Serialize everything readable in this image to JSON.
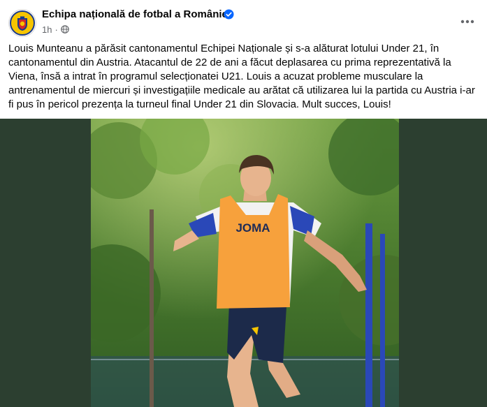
{
  "post": {
    "page_name": "Echipa națională de fotbal a României",
    "timestamp": "1h",
    "separator": "·",
    "privacy_icon": "globe-icon",
    "verified_icon": "verified-badge-icon",
    "more_icon": "more-options-icon",
    "text": "Louis Munteanu a părăsit cantonamentul Echipei Naționale și s-a alăturat lotului Under 21, în cantonamentul din Austria. Atacantul de 22 de ani a făcut deplasarea cu prima reprezentativă la Viena, însă a intrat în programul selecționatei U21. Louis a acuzat probleme musculare la antrenamentul de miercuri și investigațiile medicale au arătat că utilizarea lui la partida cu Austria i-ar fi pus în pericol prezența la turneul final Under 21 din Slovacia. Mult succes, Louis!"
  },
  "photo": {
    "bib_text": "JOMA",
    "colors": {
      "side_background": "#2c3f30",
      "bib": "#f7a13c",
      "shorts": "#1c2a4a",
      "foliage": "#4d7a35"
    }
  },
  "colors": {
    "verified": "#0866ff",
    "meta_text": "#65676b",
    "text": "#050505"
  }
}
